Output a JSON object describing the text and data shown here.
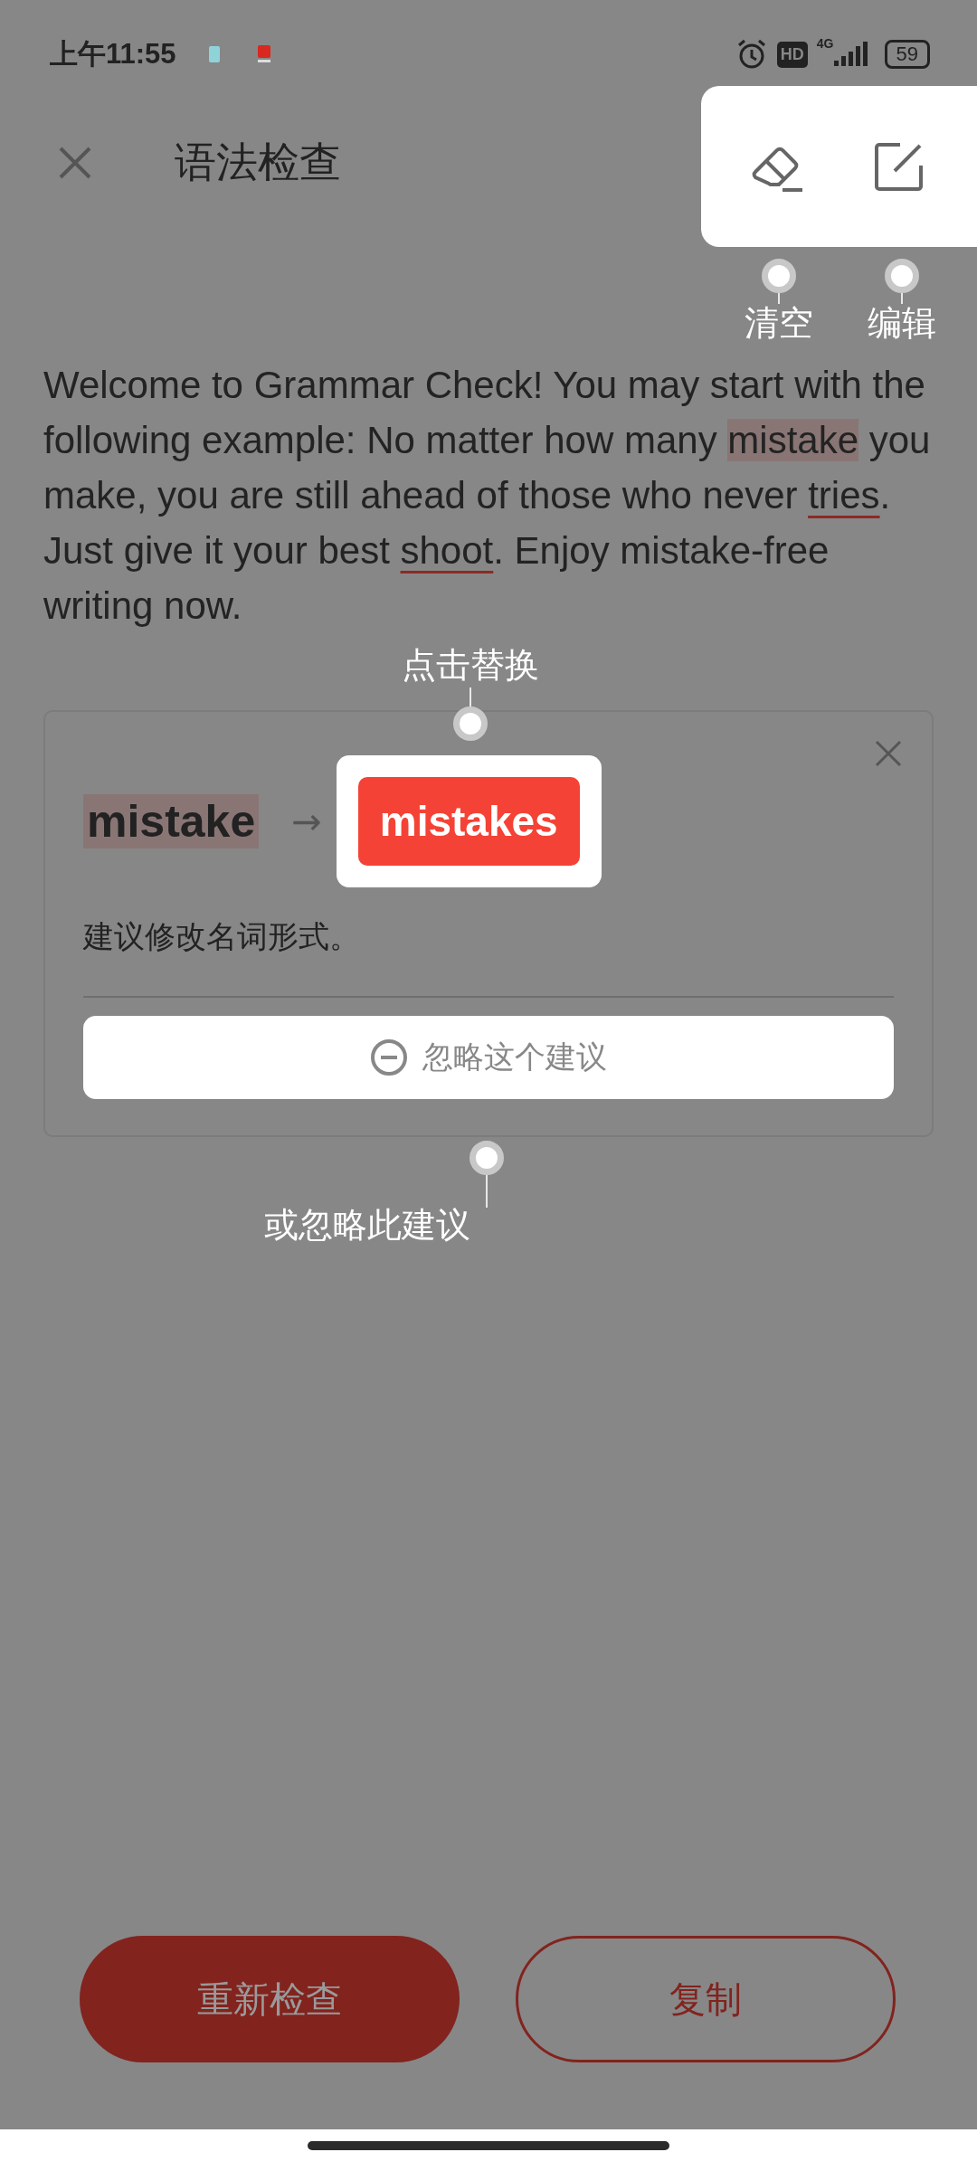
{
  "status_bar": {
    "time": "上午11:55",
    "hd": "HD",
    "network": "4G",
    "battery": "59"
  },
  "header": {
    "title": "语法检查"
  },
  "text": {
    "segments": [
      {
        "kind": "plain",
        "text": "Welcome to Grammar Check! You may start with the following example: No matter how many "
      },
      {
        "kind": "highlight",
        "text": "mistake"
      },
      {
        "kind": "plain",
        "text": " you make, you are still ahead of those who never "
      },
      {
        "kind": "underline",
        "text": "tries"
      },
      {
        "kind": "plain",
        "text": ". Just give it your best "
      },
      {
        "kind": "underline",
        "text": "shoot"
      },
      {
        "kind": "plain",
        "text": ". Enjoy mistake-free writing now."
      }
    ]
  },
  "suggestion": {
    "original": "mistake",
    "arrow": "→",
    "replacement": "mistakes",
    "explanation": "建议修改名词形式。",
    "ignore_label": "忽略这个建议"
  },
  "coach_marks": [
    {
      "label": "清空"
    },
    {
      "label": "编辑"
    },
    {
      "label": "点击替换"
    },
    {
      "label": "或忽略此建议"
    }
  ],
  "buttons": [
    {
      "label": "重新检查",
      "kind": "filled"
    },
    {
      "label": "复制",
      "kind": "outline"
    }
  ]
}
